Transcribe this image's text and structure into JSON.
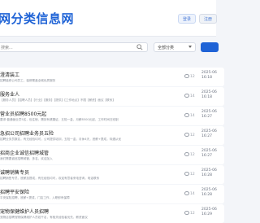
{
  "header": {
    "site_title": "网分类信息网",
    "login_label": "登录",
    "register_label": "注册"
  },
  "search": {
    "placeholder": "搜索..."
  },
  "category_select": {
    "selected": "全部分类"
  },
  "listings": [
    {
      "title": "澄清装工",
      "desc": "招聘装修公司员工，装修覆盖全城优质服务",
      "views": "12",
      "date": "2025-06",
      "time": "16:18"
    },
    {
      "title": "服务业人",
      "desc": "【服务人员】【招聘人员】【行业】【服务】【提供】【工作地点】不限【薪资】面议【联系】",
      "views": "14",
      "date": "2025-06",
      "time": "16:18"
    },
    {
      "title": "营业员招聘8500元起",
      "desc": "要求:普通营业员5名，包住宿，需持有健康证，五险一金，月薪8500元起，工作时间日班制",
      "views": "14",
      "date": "2025-06",
      "time": "16:27"
    },
    {
      "title": "急招公司招聘业务员五险",
      "desc": "招聘业务员数名，有无经验均可，公司提供培训，五险一金，月休4天，底薪+提成，待遇从优",
      "views": "12",
      "date": "2025-06",
      "time": "16:27"
    },
    {
      "title": "招商企业诚信招聘城管",
      "desc": "我们需要诚信招聘城管，多名，欢迎加入",
      "views": "12",
      "date": "2025-06",
      "time": "16:27"
    },
    {
      "title": "诚聘销售专员",
      "desc": "招聘销售专员，底薪加提成，有无经验均可，欢迎有意者来电咨询，电话联系",
      "views": "12",
      "date": "2025-06",
      "time": "16:28"
    },
    {
      "title": "招聘平安保险",
      "desc": "平安保险招聘，底薪+提成，门店工作，入职即有保障",
      "views": "14",
      "date": "2025-06",
      "time": "16:28"
    },
    {
      "title": "宠物保健维护人员招聘",
      "desc": "宠物店招聘宠物保健维护人员若干名，有相关经验者优先，薪资面议",
      "views": "12",
      "date": "2025-06",
      "time": "16:29"
    }
  ]
}
